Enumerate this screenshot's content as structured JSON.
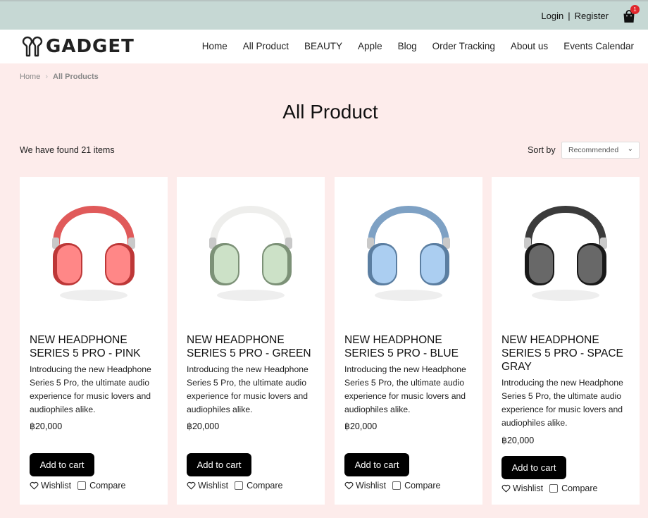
{
  "topbar": {
    "login_label": "Login",
    "separator": "|",
    "register_label": "Register",
    "cart_icon": "shopping-bag-icon",
    "cart_count": "1",
    "badge_color": "#e0262b"
  },
  "header": {
    "logo_text": "GADGET",
    "nav": [
      "Home",
      "All Product",
      "BEAUTY",
      "Apple",
      "Blog",
      "Order Tracking",
      "About us",
      "Events Calendar"
    ]
  },
  "breadcrumb": {
    "home": "Home",
    "current": "All Products"
  },
  "main": {
    "title": "All Product",
    "found_text": "We have found 21 items",
    "sort_label": "Sort by",
    "sort_value": "Recommended"
  },
  "products": [
    {
      "name": "NEW HEADPHONE SERIES 5 PRO - PINK",
      "description": "Introducing the new Headphone Series 5 Pro, the ultimate audio experience for music lovers and audiophiles alike.",
      "price": "฿20,000",
      "add_to_cart": "Add to cart",
      "wishlist": "Wishlist",
      "compare": "Compare",
      "color": "#e05a5a"
    },
    {
      "name": "NEW HEADPHONE SERIES 5 PRO - GREEN",
      "description": "Introducing the new Headphone Series 5 Pro, the ultimate audio experience for music lovers and audiophiles alike.",
      "price": "฿20,000",
      "add_to_cart": "Add to cart",
      "wishlist": "Wishlist",
      "compare": "Compare",
      "color": "#9fb49a"
    },
    {
      "name": "NEW HEADPHONE SERIES 5 PRO - BLUE",
      "description": "Introducing the new Headphone Series 5 Pro, the ultimate audio experience for music lovers and audiophiles alike.",
      "price": "฿20,000",
      "add_to_cart": "Add to cart",
      "wishlist": "Wishlist",
      "compare": "Compare",
      "color": "#7ea1c4"
    },
    {
      "name": "NEW HEADPHONE SERIES 5 PRO - SPACE GRAY",
      "description": "Introducing the new Headphone Series 5 Pro, the ultimate audio experience for music lovers and audiophiles alike.",
      "price": "฿20,000",
      "add_to_cart": "Add to cart",
      "wishlist": "Wishlist",
      "compare": "Compare",
      "color": "#3b3b3b"
    }
  ]
}
